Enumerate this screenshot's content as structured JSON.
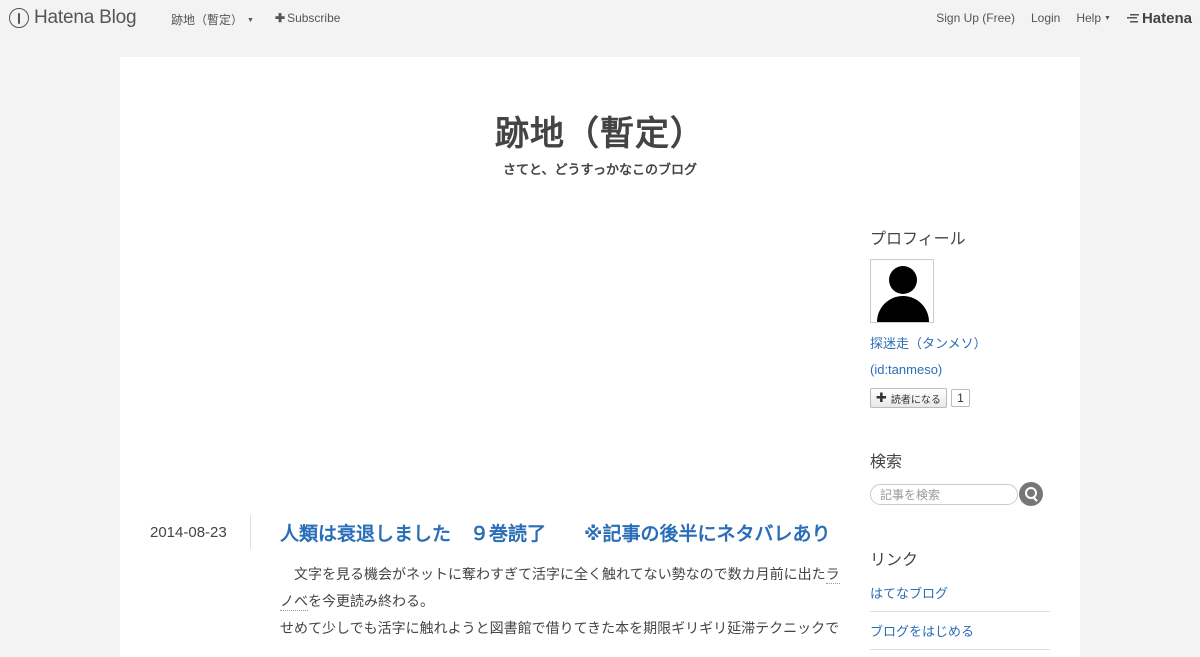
{
  "navbar": {
    "brand": "Hatena Blog",
    "blog_menu": "跡地（暫定）",
    "subscribe": "Subscribe",
    "signup": "Sign Up (Free)",
    "login": "Login",
    "help": "Help",
    "hatena": "Hatena"
  },
  "blog": {
    "title": "跡地（暫定）",
    "description": "さてと、どうすっかなこのブログ"
  },
  "entry": {
    "date": "2014-08-23",
    "title": "人類は衰退しました　９巻読了　　※記事の後半にネタバレあり",
    "p1_before": "　文字を見る機会がネットに奪わすぎて活字に全く触れてない勢なので数カ月前に出た",
    "p1_kw": "ラノベ",
    "p1_after": "を今更読み終わる。",
    "p2": "せめて少しでも活字に触れようと図書館で借りてきた本を期限ギリギリ延滞テクニックで"
  },
  "sidebar": {
    "profile_title": "プロフィール",
    "profile_name": "探迷走（タンメソ）",
    "profile_id": "(id:tanmeso)",
    "follow_label": "読者になる",
    "follow_count": "1",
    "search_title": "検索",
    "search_placeholder": "記事を検索",
    "links_title": "リンク",
    "links": [
      "はてなブログ",
      "ブログをはじめる"
    ]
  }
}
